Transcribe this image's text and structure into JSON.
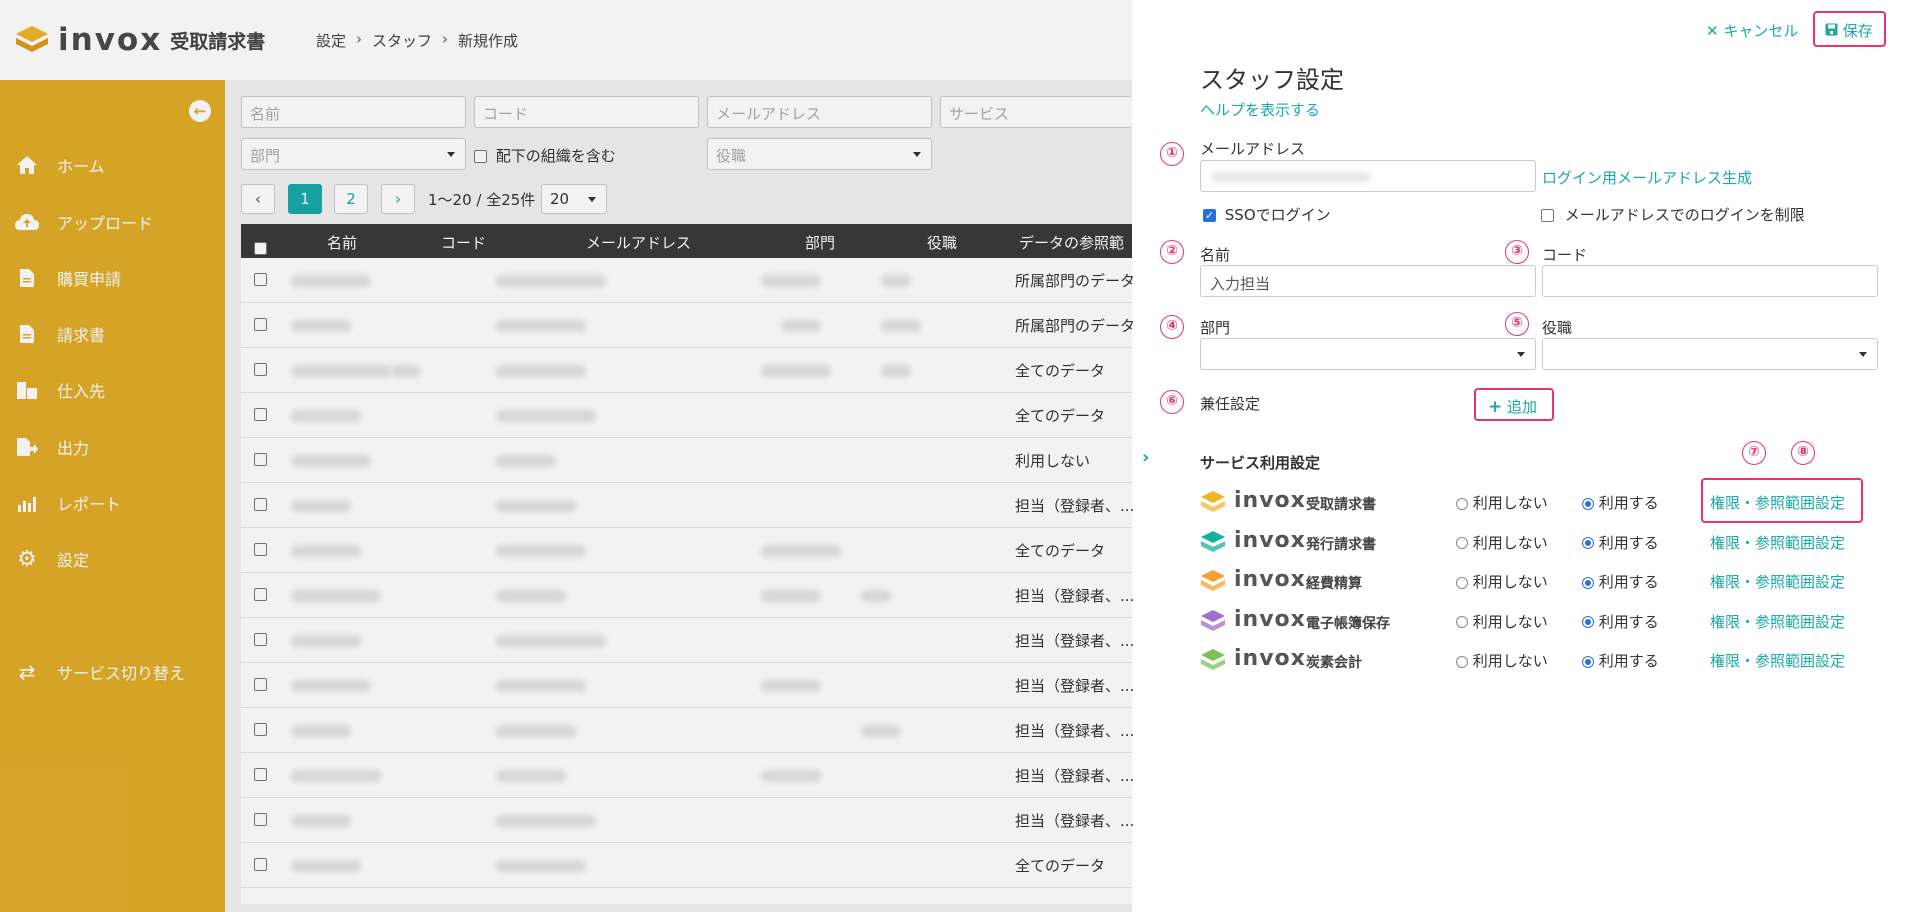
{
  "header": {
    "brand": "invox",
    "product": "受取請求書",
    "breadcrumb": [
      "設定",
      "スタッフ",
      "新規作成"
    ]
  },
  "sidebar": {
    "items": [
      {
        "label": "ホーム",
        "icon": "home-icon"
      },
      {
        "label": "アップロード",
        "icon": "upload-cloud-icon"
      },
      {
        "label": "購買申請",
        "icon": "document-icon"
      },
      {
        "label": "請求書",
        "icon": "document-icon"
      },
      {
        "label": "仕入先",
        "icon": "building-icon"
      },
      {
        "label": "出力",
        "icon": "export-icon"
      },
      {
        "label": "レポート",
        "icon": "chart-icon"
      },
      {
        "label": "設定",
        "icon": "gear-icon"
      },
      {
        "label": "サービス切り替え",
        "icon": "switch-icon"
      }
    ]
  },
  "filters": {
    "name_placeholder": "名前",
    "code_placeholder": "コード",
    "email_placeholder": "メールアドレス",
    "service_placeholder": "サービス",
    "dept_placeholder": "部門",
    "include_sub_label": "配下の組織を含む",
    "role_placeholder": "役職"
  },
  "pagination": {
    "pages": [
      "1",
      "2"
    ],
    "range_text": "1〜20 / 全25件",
    "per_page": "20"
  },
  "table": {
    "headers": [
      "名前",
      "コード",
      "メールアドレス",
      "部門",
      "役職",
      "データの参照範"
    ],
    "scopes": [
      "所属部門のデータ",
      "所属部門のデータ",
      "全てのデータ",
      "全てのデータ",
      "利用しない",
      "担当（登録者、...",
      "全てのデータ",
      "担当（登録者、...",
      "担当（登録者、...",
      "担当（登録者、...",
      "担当（登録者、...",
      "担当（登録者、...",
      "担当（登録者、...",
      "全てのデータ"
    ]
  },
  "panel": {
    "cancel_label": "キャンセル",
    "save_label": "保存",
    "title": "スタッフ設定",
    "help_link": "ヘルプを表示する",
    "markers": [
      "①",
      "②",
      "③",
      "④",
      "⑤",
      "⑥",
      "⑦",
      "⑧"
    ],
    "email_label": "メールアドレス",
    "email_value": "",
    "gen_email_link": "ログイン用メールアドレス生成",
    "sso_label": "SSOでログイン",
    "sso_checked": true,
    "restrict_label": "メールアドレスでのログインを制限",
    "restrict_checked": false,
    "name_label": "名前",
    "name_value": "入力担当",
    "code_label": "コード",
    "code_value": "",
    "dept_label": "部門",
    "role_label": "役職",
    "concurrent_label": "兼任設定",
    "add_label": "追加",
    "service_section_title": "サービス利用設定",
    "services": [
      {
        "brand": "invox",
        "name": "受取請求書",
        "color": "#f0b429",
        "off_label": "利用しない",
        "on_label": "利用する",
        "enabled": true,
        "perm_link": "権限・参照範囲設定"
      },
      {
        "brand": "invox",
        "name": "発行請求書",
        "color": "#1ab0a0",
        "off_label": "利用しない",
        "on_label": "利用する",
        "enabled": true,
        "perm_link": "権限・参照範囲設定"
      },
      {
        "brand": "invox",
        "name": "経費精算",
        "color": "#f5a030",
        "off_label": "利用しない",
        "on_label": "利用する",
        "enabled": true,
        "perm_link": "権限・参照範囲設定"
      },
      {
        "brand": "invox",
        "name": "電子帳簿保存",
        "color": "#a070d0",
        "off_label": "利用しない",
        "on_label": "利用する",
        "enabled": true,
        "perm_link": "権限・参照範囲設定"
      },
      {
        "brand": "invox",
        "name": "炭素会計",
        "color": "#7cc05a",
        "off_label": "利用しない",
        "on_label": "利用する",
        "enabled": true,
        "perm_link": "権限・参照範囲設定"
      }
    ]
  },
  "colors": {
    "sidebar": "#e1ad2a",
    "accent": "#1aa8a8",
    "highlight": "#e8336e"
  }
}
